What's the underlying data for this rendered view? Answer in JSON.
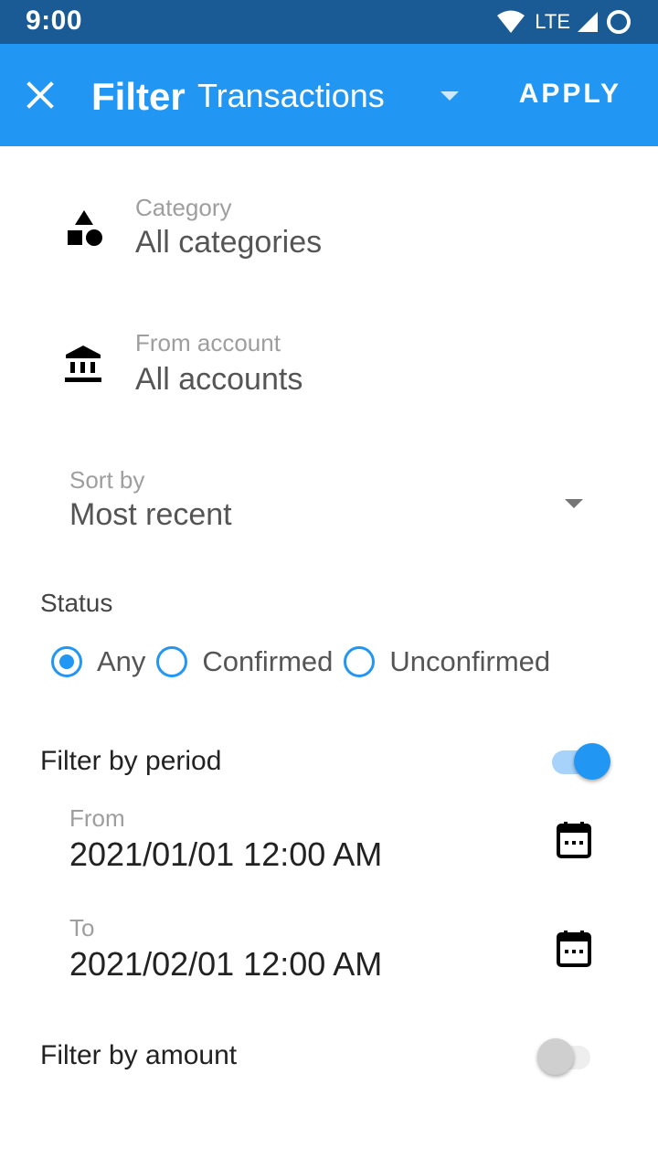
{
  "status_bar": {
    "time": "9:00",
    "network": "LTE"
  },
  "app_bar": {
    "title": "Filter",
    "type_select": "Transactions",
    "apply_label": "APPLY"
  },
  "category": {
    "label": "Category",
    "value": "All categories"
  },
  "account": {
    "label": "From account",
    "value": "All accounts"
  },
  "sort": {
    "label": "Sort by",
    "value": "Most recent"
  },
  "status": {
    "heading": "Status",
    "options": [
      {
        "label": "Any",
        "selected": true
      },
      {
        "label": "Confirmed",
        "selected": false
      },
      {
        "label": "Unconfirmed",
        "selected": false
      }
    ]
  },
  "period": {
    "label": "Filter by period",
    "enabled": true,
    "from_label": "From",
    "from_value": "2021/01/01 12:00 AM",
    "to_label": "To",
    "to_value": "2021/02/01 12:00 AM"
  },
  "amount": {
    "label": "Filter by amount",
    "enabled": false
  },
  "colors": {
    "primary": "#2196f3",
    "status_bar": "#1a5b96"
  }
}
